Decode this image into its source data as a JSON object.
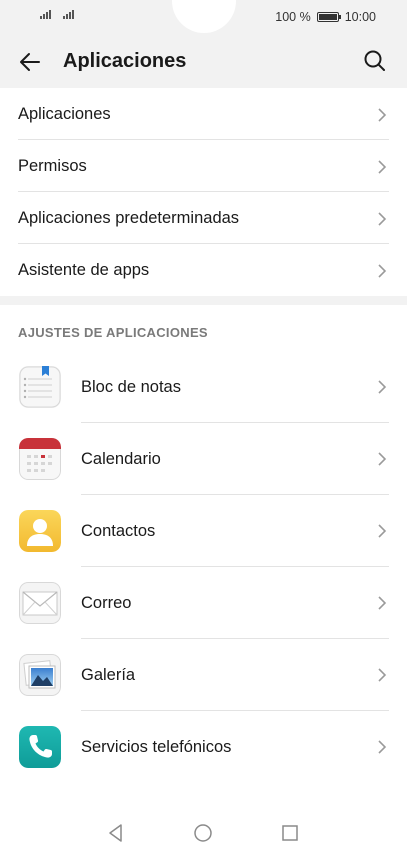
{
  "status_bar": {
    "battery_text": "100 %",
    "time": "10:00",
    "battery_level_percent": 100
  },
  "app_bar": {
    "title": "Aplicaciones",
    "back_icon": "arrow-left-icon",
    "search_icon": "search-icon"
  },
  "main_menu": {
    "items": [
      {
        "label": "Aplicaciones"
      },
      {
        "label": "Permisos"
      },
      {
        "label": "Aplicaciones predeterminadas"
      },
      {
        "label": "Asistente de apps"
      }
    ]
  },
  "app_settings": {
    "header": "AJUSTES DE APLICACIONES",
    "items": [
      {
        "label": "Bloc de notas",
        "icon": "notepad-icon"
      },
      {
        "label": "Calendario",
        "icon": "calendar-icon"
      },
      {
        "label": "Contactos",
        "icon": "contacts-icon"
      },
      {
        "label": "Correo",
        "icon": "mail-icon"
      },
      {
        "label": "Galería",
        "icon": "gallery-icon"
      },
      {
        "label": "Servicios telefónicos",
        "icon": "phone-icon"
      }
    ]
  },
  "nav_bar": {
    "back": "nav-back-icon",
    "home": "nav-home-icon",
    "recents": "nav-recents-icon"
  },
  "colors": {
    "background": "#f2f2f2",
    "card": "#ffffff",
    "calendar_red": "#c8323a",
    "contacts_yellow": "#f5c843",
    "phone_teal": "#16a8a4",
    "bookmark_blue": "#2b7fd6"
  }
}
